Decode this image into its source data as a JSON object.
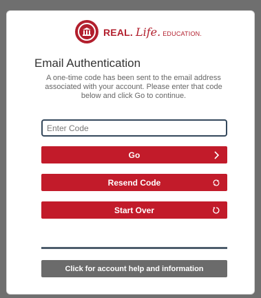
{
  "logo": {
    "brand_bold": "REAL.",
    "brand_script": "Life.",
    "brand_small": "EDUCATION."
  },
  "auth": {
    "title": "Email Authentication",
    "description": "A one-time code has been sent to the email address associated with your account. Please enter that code below and click Go to continue.",
    "code_placeholder": "Enter Code",
    "code_value": ""
  },
  "buttons": {
    "go": {
      "label": "Go",
      "icon": "chevron-right-icon"
    },
    "resend": {
      "label": "Resend Code",
      "icon": "refresh-icon"
    },
    "start_over": {
      "label": "Start Over",
      "icon": "restart-icon"
    },
    "help": {
      "label": "Click for account help and information"
    }
  },
  "colors": {
    "brand_red": "#c21b2a",
    "help_gray": "#6b6b6b",
    "divider": "#4c5c6b",
    "background": "#6f6f6f"
  }
}
